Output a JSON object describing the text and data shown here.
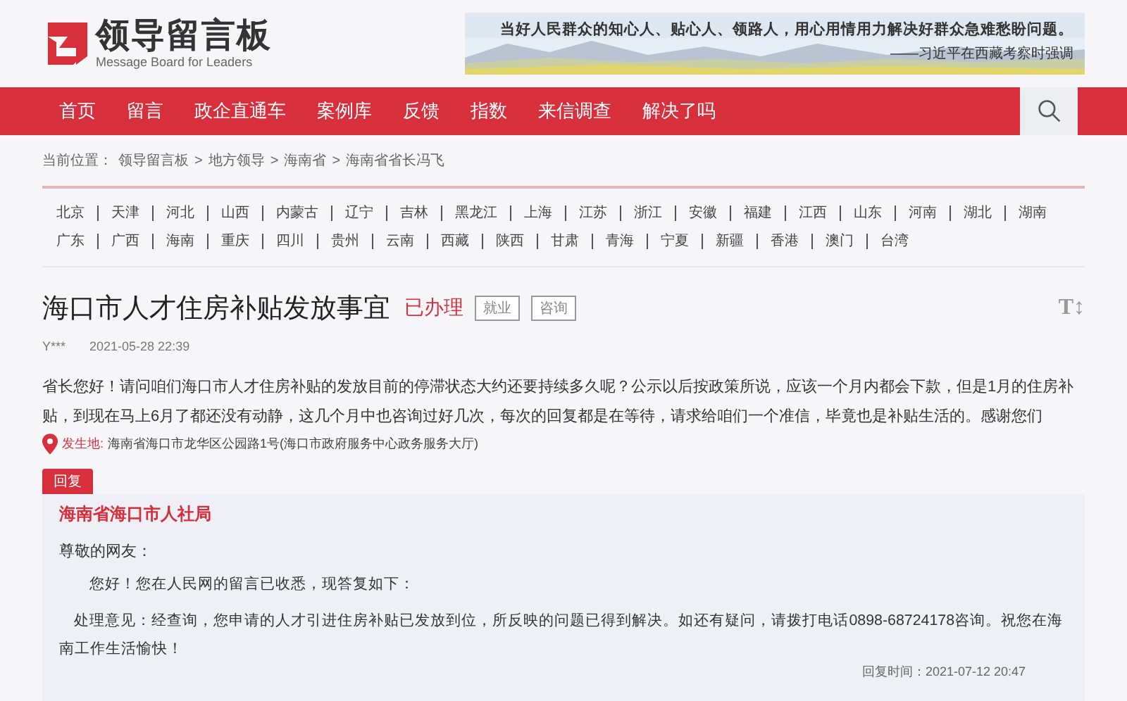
{
  "header": {
    "logo_title": "领导留言板",
    "logo_subtitle": "Message Board for Leaders",
    "banner": {
      "slogan": "当好人民群众的知心人、贴心人、领路人，用心用情用力解决好群众急难愁盼问题。",
      "source": "——习近平在西藏考察时强调"
    }
  },
  "nav": {
    "items": [
      "首页",
      "留言",
      "政企直通车",
      "案例库",
      "反馈",
      "指数",
      "来信调查",
      "解决了吗"
    ]
  },
  "breadcrumb": {
    "label": "当前位置：",
    "items": [
      "领导留言板",
      "地方领导",
      "海南省",
      "海南省省长冯飞"
    ],
    "separator": ">"
  },
  "regions": [
    [
      "北京",
      "天津",
      "河北",
      "山西",
      "内蒙古",
      "辽宁",
      "吉林",
      "黑龙江",
      "上海",
      "江苏",
      "浙江",
      "安徽",
      "福建",
      "江西",
      "山东",
      "河南",
      "湖北",
      "湖南"
    ],
    [
      "广东",
      "广西",
      "海南",
      "重庆",
      "四川",
      "贵州",
      "云南",
      "西藏",
      "陕西",
      "甘肃",
      "青海",
      "宁夏",
      "新疆",
      "香港",
      "澳门",
      "台湾"
    ]
  ],
  "message": {
    "title": "海口市人才住房补贴发放事宜",
    "status": "已办理",
    "tags": [
      "就业",
      "咨询"
    ],
    "font_toggle": "T↕",
    "author": "Y***",
    "date": "2021-05-28 22:39",
    "body": "省长您好！请问咱们海口市人才住房补贴的发放目前的停滞状态大约还要持续多久呢？公示以后按政策所说，应该一个月内都会下款，但是1月的住房补贴，到现在马上6月了都还没有动静，这几个月中也咨询过好几次，每次的回复都是在等待，请求给咱们一个准信，毕竟也是补贴生活的。感谢您们",
    "location_label": "发生地:",
    "location": "海南省海口市龙华区公园路1号(海口市政府服务中心政务服务大厅)"
  },
  "reply": {
    "tab": "回复",
    "department": "海南省海口市人社局",
    "greeting": "尊敬的网友：",
    "paragraphs": [
      "您好！您在人民网的留言已收悉，现答复如下：",
      "处理意见：经查询，您申请的人才引进住房补贴已发放到位，所反映的问题已得到解决。如还有疑问，请拨打电话0898-68724178咨询。祝您在海南工作生活愉快！"
    ],
    "time": "回复时间：2021-07-12 20:47"
  }
}
